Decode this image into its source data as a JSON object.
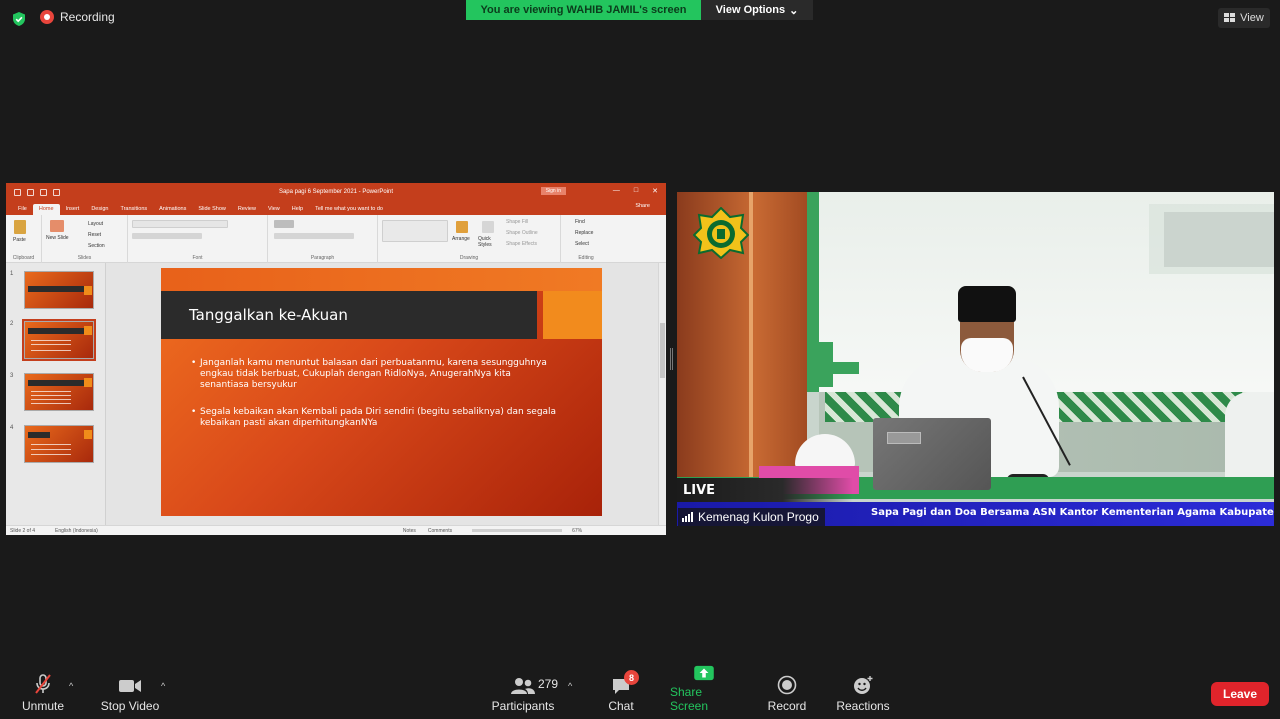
{
  "topbar": {
    "recording_label": "Recording",
    "viewing_banner": "You are viewing WAHIB JAMIL's screen",
    "view_options_label": "View Options",
    "view_label": "View"
  },
  "powerpoint": {
    "window_title": "Sapa pagi 6 September 2021  -  PowerPoint",
    "sign_in_label": "Sign in",
    "tabs": [
      "File",
      "Home",
      "Insert",
      "Design",
      "Transitions",
      "Animations",
      "Slide Show",
      "Review",
      "View",
      "Help"
    ],
    "tell_me": "Tell me what you want to do",
    "share_label": "Share",
    "ribbon": {
      "clipboard": "Clipboard",
      "paste": "Paste",
      "slides": "Slides",
      "new_slide": "New Slide",
      "layout": "Layout",
      "reset": "Reset",
      "section": "Section",
      "font": "Font",
      "paragraph": "Paragraph",
      "drawing": "Drawing",
      "arrange": "Arrange",
      "quick_styles": "Quick Styles",
      "shape_fill": "Shape Fill",
      "shape_outline": "Shape Outline",
      "shape_effects": "Shape Effects",
      "editing": "Editing",
      "find": "Find",
      "replace": "Replace",
      "select": "Select"
    },
    "thumbnail_numbers": [
      "1",
      "2",
      "3",
      "4"
    ],
    "slide": {
      "title": "Tanggalkan ke-Akuan",
      "bullets": [
        "Janganlah kamu menuntut balasan dari perbuatanmu, karena sesungguhnya engkau tidak berbuat, Cukuplah dengan RidloNya, AnugerahNya kita senantiasa bersyukur",
        "Segala kebaikan akan Kembali pada Diri sendiri (begitu sebaliknya) dan segala kebaikan pasti akan diperhitungkanNYa"
      ]
    },
    "status": {
      "slide_counter": "Slide 2 of 4",
      "language": "English (Indonesia)",
      "notes": "Notes",
      "comments": "Comments",
      "zoom": "67%"
    }
  },
  "video": {
    "live_label": "LIVE",
    "participant_name": "Kemenag Kulon Progo",
    "ticker": "Sapa Pagi dan Doa Bersama ASN Kantor Kementerian Agama Kabupaten Ku"
  },
  "toolbar": {
    "unmute": "Unmute",
    "stop_video": "Stop Video",
    "participants": "Participants",
    "participants_count": "279",
    "chat": "Chat",
    "chat_badge": "8",
    "share_screen": "Share Screen",
    "record": "Record",
    "reactions": "Reactions",
    "leave": "Leave"
  },
  "colors": {
    "zoom_green": "#23c55e",
    "leave_red": "#e0242b",
    "ppt_red": "#c43e1c",
    "ticker_blue": "#2c2cd8"
  }
}
